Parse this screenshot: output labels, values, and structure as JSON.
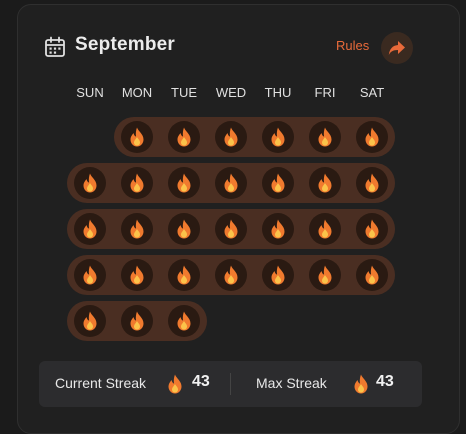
{
  "header": {
    "month": "September",
    "rules_label": "Rules",
    "calendar_icon": "calendar-icon",
    "share_icon": "share-arrow-icon"
  },
  "weekdays": [
    "SUN",
    "MON",
    "TUE",
    "WED",
    "THU",
    "FRI",
    "SAT"
  ],
  "weeks": [
    {
      "start_col": 1,
      "days": 6
    },
    {
      "start_col": 0,
      "days": 7
    },
    {
      "start_col": 0,
      "days": 7
    },
    {
      "start_col": 0,
      "days": 7
    },
    {
      "start_col": 0,
      "days": 3
    }
  ],
  "day_icon": "flame-icon",
  "stats": {
    "current_label": "Current Streak",
    "current_value": "43",
    "max_label": "Max Streak",
    "max_value": "43"
  },
  "colors": {
    "accent": "#e86a3a",
    "week_bar": "#4a2e22",
    "day_circle": "#2a1a12",
    "flame_outer": "#f07a2e",
    "flame_inner": "#fbc34a"
  }
}
